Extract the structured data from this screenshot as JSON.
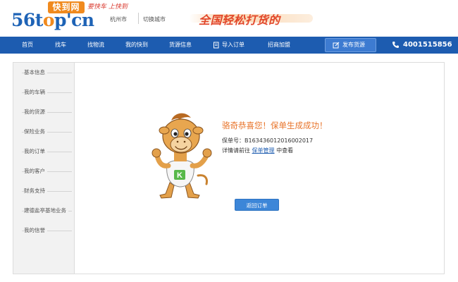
{
  "header": {
    "logo_badge": "快到网",
    "logo_text_1": "56t",
    "logo_text_o": "o",
    "logo_text_2": "p'cn",
    "slogan": "要快车 上快到",
    "city": "杭州市",
    "switch_city": "切换城市",
    "banner": "全国轻松打货的"
  },
  "nav": {
    "items": [
      "首页",
      "找车",
      "找物流",
      "我的快到",
      "货源信息",
      "导入订单",
      "招商加盟"
    ],
    "publish": "发布货源",
    "hotline": "4001515856"
  },
  "sidebar": {
    "items": [
      "基本信息",
      "我的车辆",
      "我的货源",
      "保险业务",
      "我的订单",
      "我的客户",
      "财务支持",
      "建德盐亭基地业务",
      "我的信誉"
    ]
  },
  "main": {
    "success_title": "骆奇恭喜您！保单生成成功！",
    "policy_label": "保单号：",
    "policy_number": "B163436012016002017",
    "detail_prefix": "详情请前往",
    "detail_link": "保单管理",
    "detail_suffix": "中查看",
    "back_button": "返回订单",
    "mascot_letter": "K"
  },
  "colors": {
    "brand_blue": "#1d5cb0",
    "brand_orange": "#f08a1e",
    "success_orange": "#e8742a",
    "button_blue": "#3c86d8"
  },
  "icons": {
    "import": "import-order-icon",
    "publish": "publish-edit-icon",
    "phone": "phone-icon"
  }
}
